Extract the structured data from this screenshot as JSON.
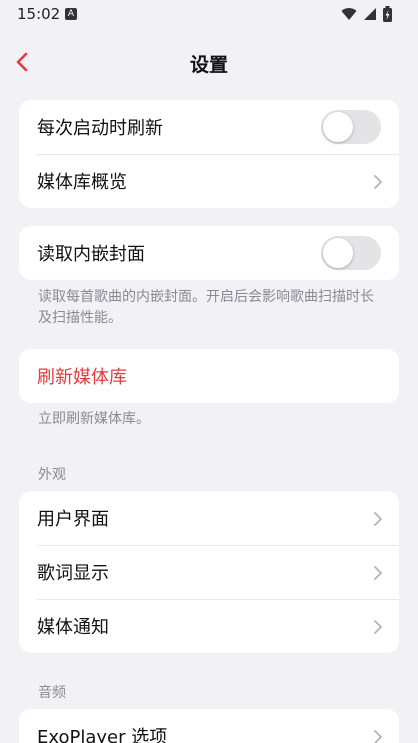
{
  "status_bar": {
    "time": "15:02",
    "notification_icon": "A"
  },
  "header": {
    "title": "设置",
    "back_icon": "chevron-left-icon"
  },
  "colors": {
    "accent": "#e5393d",
    "background": "#f2f1f6",
    "card": "#ffffff",
    "secondary_text": "#8a8a90"
  },
  "group1": {
    "refresh_on_start": {
      "label": "每次启动时刷新",
      "enabled": false
    },
    "library_overview": {
      "label": "媒体库概览"
    }
  },
  "group2": {
    "read_embedded_cover": {
      "label": "读取内嵌封面",
      "enabled": false
    },
    "footnote": "读取每首歌曲的内嵌封面。开启后会影响歌曲扫描时长及扫描性能。"
  },
  "group3": {
    "refresh_library": {
      "label": "刷新媒体库"
    },
    "footnote": "立即刷新媒体库。"
  },
  "appearance": {
    "header": "外观",
    "items": [
      {
        "label": "用户界面"
      },
      {
        "label": "歌词显示"
      },
      {
        "label": "媒体通知"
      }
    ]
  },
  "audio": {
    "header": "音频",
    "items": [
      {
        "label": "ExoPlayer 选项"
      }
    ]
  }
}
